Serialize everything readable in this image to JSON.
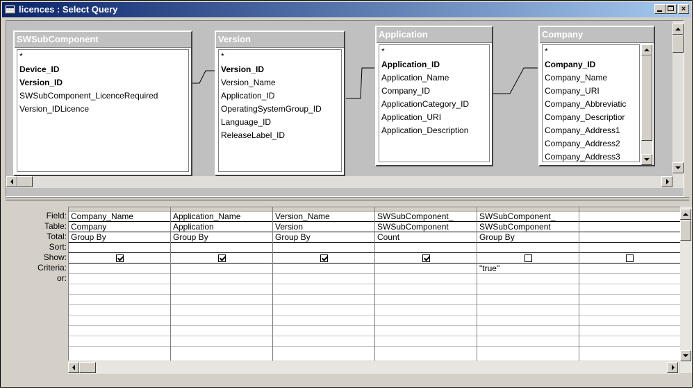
{
  "window": {
    "title": "licences : Select Query"
  },
  "tables": [
    {
      "name": "SWSubComponent",
      "fields": [
        "*",
        "Device_ID",
        "Version_ID",
        "SWSubComponent_LicenceRequired",
        "Version_IDLicence"
      ],
      "primary_keys": [
        "Device_ID",
        "Version_ID"
      ]
    },
    {
      "name": "Version",
      "fields": [
        "*",
        "Version_ID",
        "Version_Name",
        "Application_ID",
        "OperatingSystemGroup_ID",
        "Language_ID",
        "ReleaseLabel_ID"
      ],
      "primary_keys": [
        "Version_ID"
      ]
    },
    {
      "name": "Application",
      "fields": [
        "*",
        "Application_ID",
        "Application_Name",
        "Company_ID",
        "ApplicationCategory_ID",
        "Application_URI",
        "Application_Description"
      ],
      "primary_keys": [
        "Application_ID"
      ]
    },
    {
      "name": "Company",
      "fields": [
        "*",
        "Company_ID",
        "Company_Name",
        "Company_URI",
        "Company_Abbreviatic",
        "Company_Descriptior",
        "Company_Address1",
        "Company_Address2",
        "Company_Address3"
      ],
      "primary_keys": [
        "Company_ID"
      ]
    }
  ],
  "grid": {
    "row_labels": {
      "field": "Field:",
      "table": "Table:",
      "total": "Total:",
      "sort": "Sort:",
      "show": "Show:",
      "criteria": "Criteria:",
      "or": "or:"
    },
    "columns": [
      {
        "field": "Company_Name",
        "table": "Company",
        "total": "Group By",
        "sort": "",
        "show": true,
        "criteria": ""
      },
      {
        "field": "Application_Name",
        "table": "Application",
        "total": "Group By",
        "sort": "",
        "show": true,
        "criteria": ""
      },
      {
        "field": "Version_Name",
        "table": "Version",
        "total": "Group By",
        "sort": "",
        "show": true,
        "criteria": ""
      },
      {
        "field": "SWSubComponent_",
        "table": "SWSubComponent",
        "total": "Count",
        "sort": "",
        "show": true,
        "criteria": ""
      },
      {
        "field": "SWSubComponent_",
        "table": "SWSubComponent",
        "total": "Group By",
        "sort": "",
        "show": false,
        "criteria": "\"true\""
      },
      {
        "field": "",
        "table": "",
        "total": "",
        "sort": "",
        "show": false,
        "criteria": ""
      }
    ]
  }
}
